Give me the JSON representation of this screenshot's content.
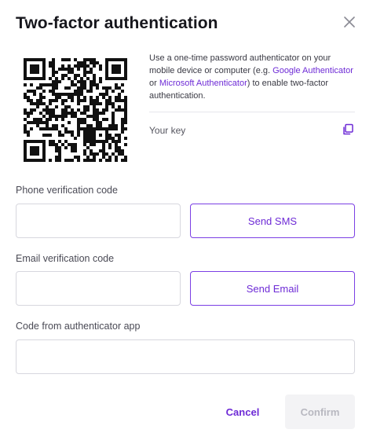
{
  "dialog": {
    "title": "Two-factor authentication",
    "close_icon": "close-icon"
  },
  "qr": {
    "icon": "qr-code"
  },
  "description": {
    "part1": "Use a one-time password authenticator on your mobile device or computer (e.g. ",
    "link1": "Google Authenticator",
    "part2": " or ",
    "link2": "Microsoft Authenticator",
    "part3": ") to enable two-factor authentication."
  },
  "key": {
    "label": "Your key",
    "copy_icon": "copy-icon"
  },
  "phone": {
    "label": "Phone verification code",
    "value": "",
    "button": "Send SMS"
  },
  "email": {
    "label": "Email verification code",
    "value": "",
    "button": "Send Email"
  },
  "authenticator": {
    "label": "Code from authenticator app",
    "value": ""
  },
  "actions": {
    "cancel": "Cancel",
    "confirm": "Confirm"
  },
  "colors": {
    "accent": "#6e2bd6",
    "border": "#d7d7de",
    "disabled_bg": "#f3f3f5",
    "disabled_text": "#b8b8c0"
  }
}
